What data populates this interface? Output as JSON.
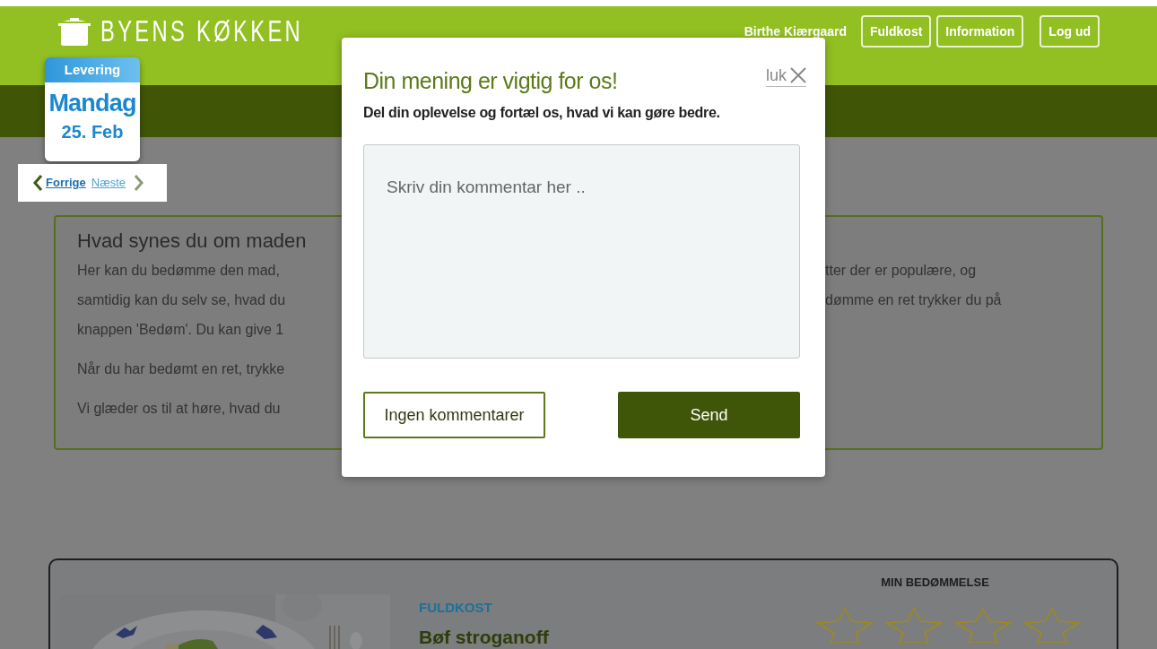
{
  "header": {
    "logo": "BYENS KØKKEN",
    "user": "Birthe Kiærgaard",
    "buttons": [
      "Fuldkost",
      "Information",
      "Log ud"
    ]
  },
  "delivery": {
    "label": "Levering",
    "day": "Mandag",
    "date": "25. Feb",
    "prev": "Forrige",
    "next": "Næste"
  },
  "intro": {
    "title": "Hvad synes du om maden",
    "paragraphs": [
      [
        {
          "left": "Her kan du bedømme den mad,",
          "right": "tter der er populære, og"
        },
        {
          "left": "samtidig kan du selv se, hvad du",
          "right": "dømme en ret trykker du på"
        },
        {
          "left": "knappen 'Bedøm'. Du kan give 1"
        }
      ],
      [
        {
          "left": "Når du har bedømt en ret, trykke"
        }
      ],
      [
        {
          "left": "Vi glæder os til at høre, hvad du"
        }
      ]
    ]
  },
  "dish": {
    "category": "FULDKOST",
    "name": "Bøf stroganoff",
    "rating_label": "MIN BEDØMMELSE",
    "stars": 0
  },
  "modal": {
    "title": "Din mening er vigtig for os!",
    "close": "luk",
    "subtitle": "Del din oplevelse og fortæl os, hvad vi kan gøre bedre.",
    "comment": {
      "placeholder": "Skriv din kommentar her .."
    },
    "buttons": [
      {
        "label": "Ingen kommentarer",
        "kind": "secondary"
      },
      {
        "label": "Send",
        "kind": "primary"
      }
    ]
  }
}
